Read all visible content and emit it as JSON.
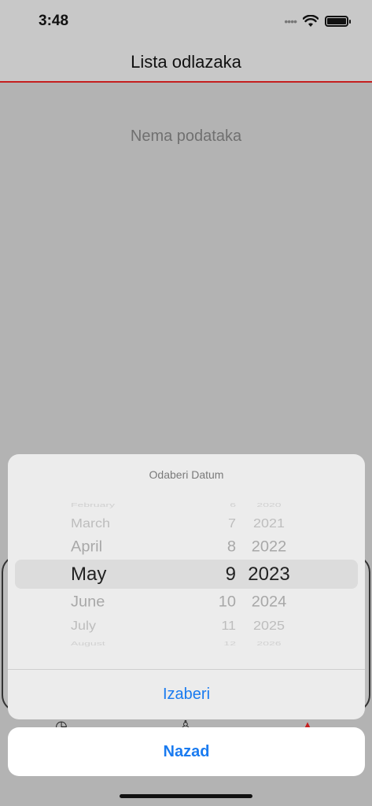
{
  "status": {
    "time": "3:48",
    "signal_icon": "signal-dots-icon",
    "wifi_icon": "wifi-icon",
    "battery_icon": "battery-icon"
  },
  "nav": {
    "title": "Lista odlazaka"
  },
  "main": {
    "empty_text": "Nema podataka"
  },
  "picker": {
    "title": "Odaberi Datum",
    "months": [
      "February",
      "March",
      "April",
      "May",
      "June",
      "July",
      "August"
    ],
    "days": [
      "6",
      "7",
      "8",
      "9",
      "10",
      "11",
      "12"
    ],
    "years": [
      "2020",
      "2021",
      "2022",
      "2023",
      "2024",
      "2025",
      "2026"
    ],
    "selected": {
      "month": "May",
      "day": "9",
      "year": "2023"
    }
  },
  "sheet": {
    "choose_label": "Izaberi",
    "cancel_label": "Nazad"
  },
  "colors": {
    "accent": "#1a7bf0",
    "nav_underline": "#c51f1f"
  },
  "tab_icons": [
    "clock-icon",
    "person-icon",
    "location-arrow-icon"
  ]
}
